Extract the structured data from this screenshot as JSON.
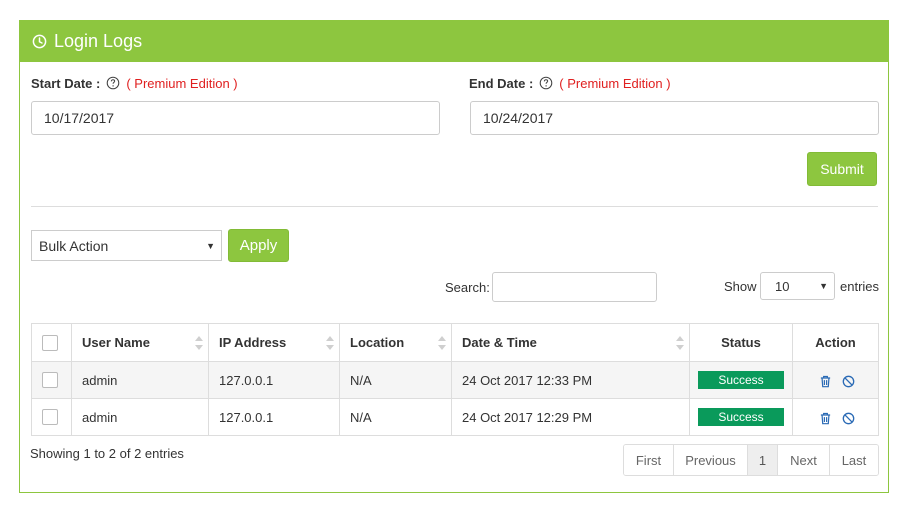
{
  "panel": {
    "title": "Login Logs"
  },
  "filters": {
    "start_label": "Start Date :",
    "end_label": "End Date :",
    "premium_note": "( Premium Edition )",
    "start_value": "10/17/2017",
    "end_value": "10/24/2017",
    "submit_label": "Submit"
  },
  "bulk": {
    "selected": "Bulk Action",
    "apply_label": "Apply"
  },
  "search": {
    "label": "Search:",
    "value": ""
  },
  "length": {
    "show_label": "Show",
    "value": "10",
    "entries_label": "entries"
  },
  "table": {
    "columns": [
      "User Name",
      "IP Address",
      "Location",
      "Date & Time",
      "Status",
      "Action"
    ],
    "rows": [
      {
        "user": "admin",
        "ip": "127.0.0.1",
        "location": "N/A",
        "datetime": "24 Oct 2017 12:33 PM",
        "status": "Success"
      },
      {
        "user": "admin",
        "ip": "127.0.0.1",
        "location": "N/A",
        "datetime": "24 Oct 2017 12:29 PM",
        "status": "Success"
      }
    ]
  },
  "info": "Showing 1 to 2 of 2 entries",
  "pagination": {
    "first": "First",
    "previous": "Previous",
    "current": "1",
    "next": "Next",
    "last": "Last"
  },
  "colors": {
    "accent": "#8dc63f",
    "success": "#0a9a5b",
    "premium": "#e02020",
    "action_icons": "#2a6ab5"
  },
  "icons": {
    "title": "clock-icon",
    "help": "question-circle-icon",
    "delete": "trash-icon",
    "block": "ban-icon"
  }
}
